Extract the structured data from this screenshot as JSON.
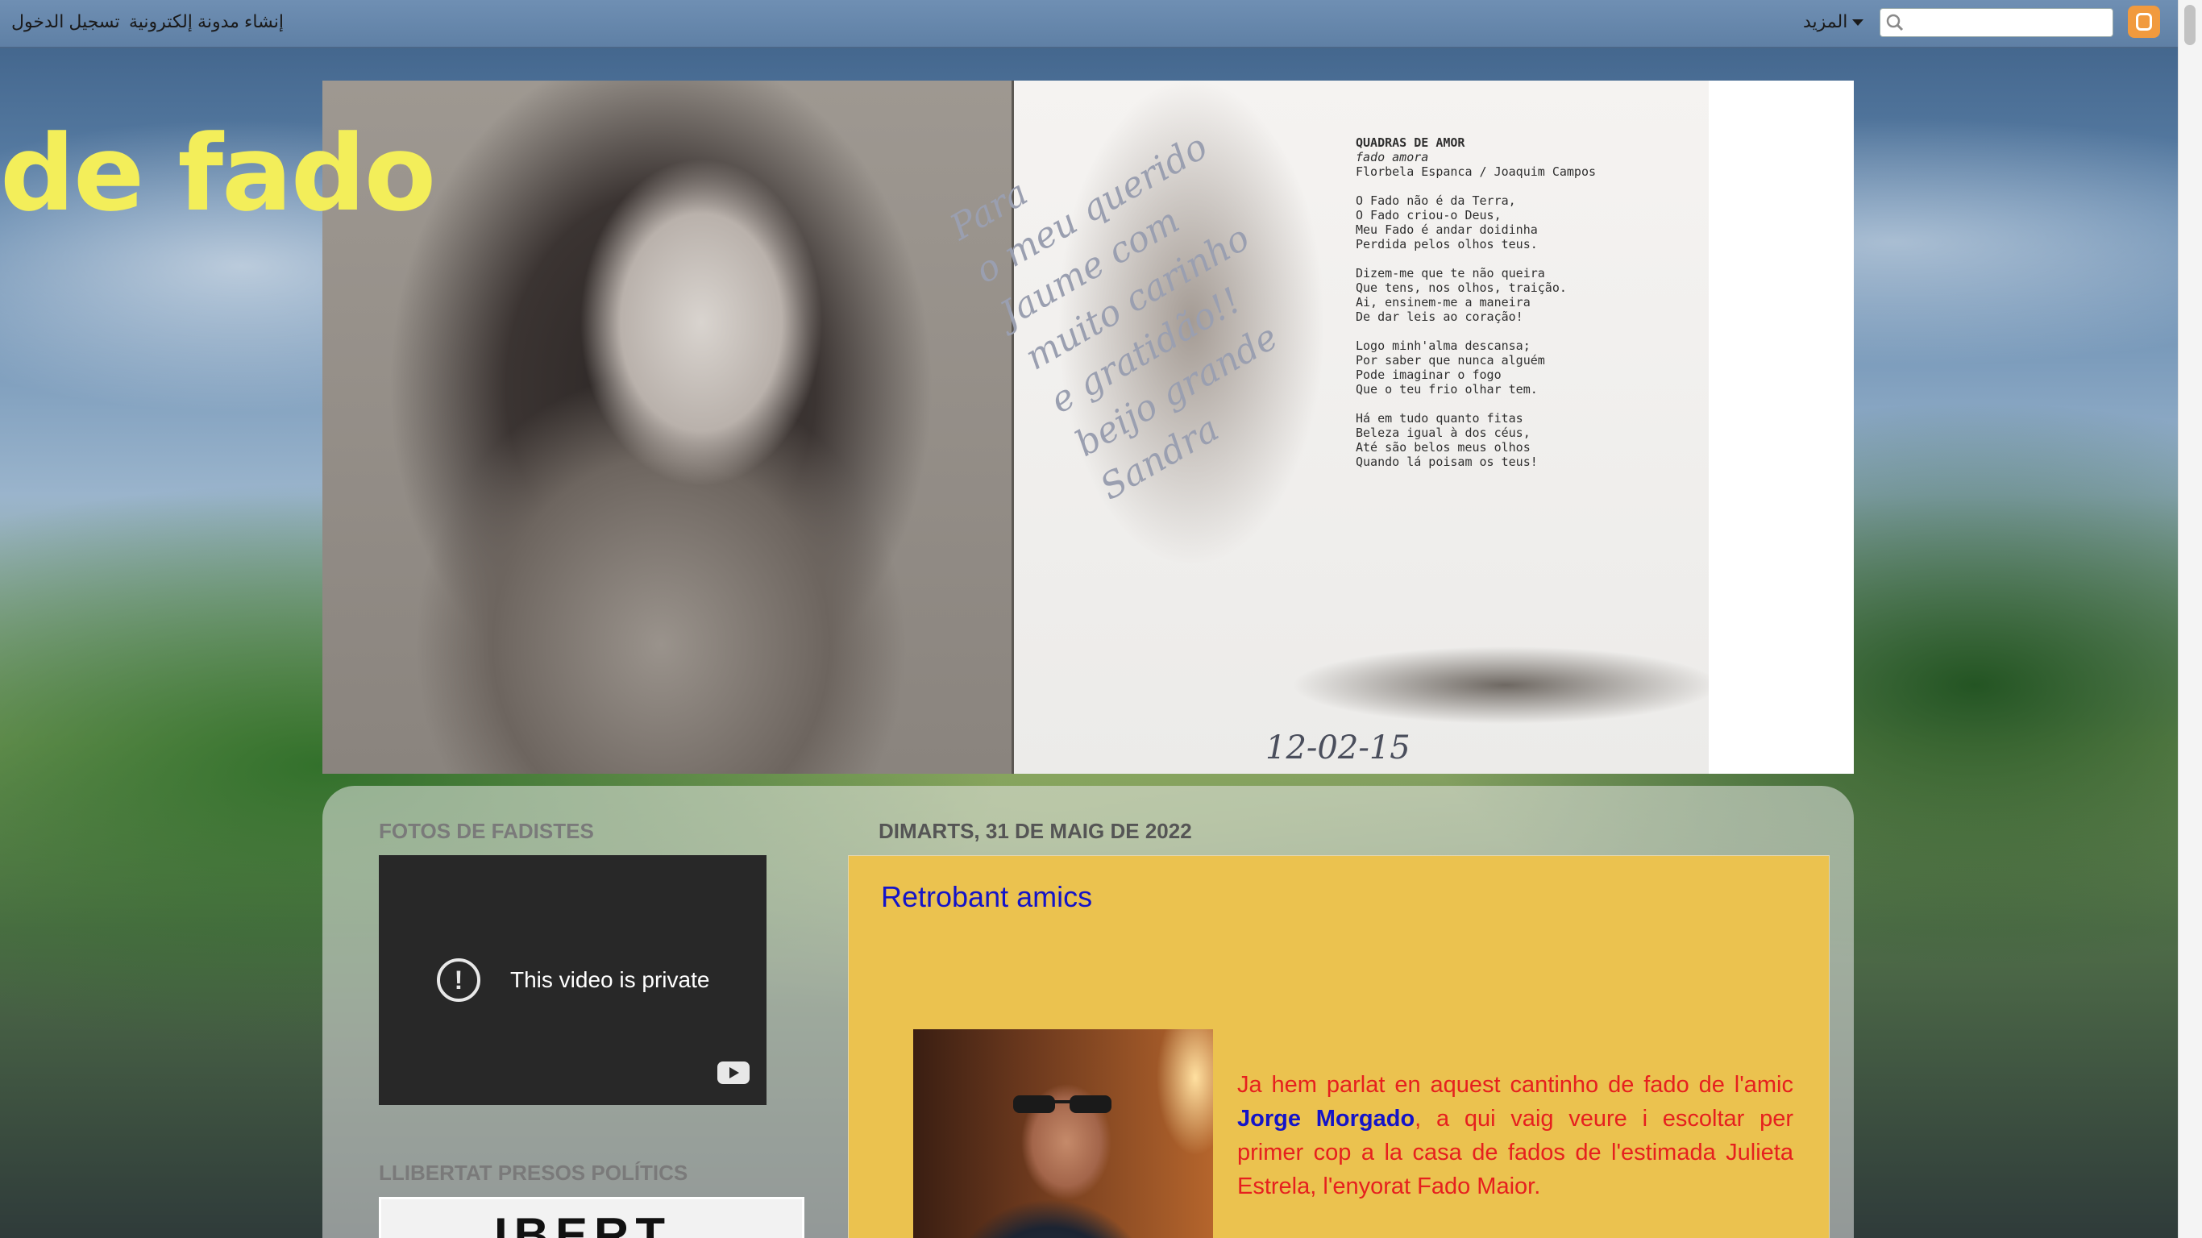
{
  "navbar": {
    "signin": "تسجيل الدخول",
    "create_blog": "إنشاء مدونة إلكترونية",
    "more": "المزيد",
    "search_placeholder": ""
  },
  "header": {
    "title": "de fado",
    "poem": {
      "heading": "QUADRAS DE AMOR",
      "subtitle": "fado amora",
      "authors": "Florbela Espanca / Joaquim Campos",
      "stanza1": "O Fado não é da Terra,\nO Fado criou-o Deus,\nMeu Fado é andar doidinha\nPerdida pelos olhos teus.",
      "stanza2": "Dizem-me que te não queira\nQue tens, nos olhos, traição.\nAi, ensinem-me a maneira\nDe dar leis ao coração!",
      "stanza3": "Logo minh'alma descansa;\nPor saber que nunca alguém\nPode imaginar o fogo\nQue o teu frio olhar tem.",
      "stanza4": "Há em tudo quanto fitas\nBeleza igual à dos céus,\nAté são belos meus olhos\nQuando lá poisam os teus!"
    },
    "handwriting": "Para\no meu querido\nJaume com\nmuito carinho\ne gratidão!!\nbeijo grande\nSandra",
    "handwritten_date": "12-02-15"
  },
  "sidebar": {
    "widget1_title": "FOTOS DE FADISTES",
    "video_message": "This video is private",
    "widget2_title": "LLIBERTAT PRESOS POLÍTICS",
    "widget2_image_text": "IBERT"
  },
  "post": {
    "date": "DIMARTS, 31 DE MAIG DE 2022",
    "title": "Retrobant amics",
    "text_before": "Ja hem parlat en aquest cantinho de fado de l'amic ",
    "name": "Jorge Morgado",
    "text_after": ", a qui vaig veure i escoltar per primer cop a la casa de fados de l'estimada  Julieta Estrela, l'enyorat Fado Maior."
  },
  "colors": {
    "title_yellow": "#f3ee5a",
    "post_background": "#ebc24f",
    "post_title": "#1414c8",
    "post_text": "#e6201e",
    "blogger_orange": "#f19a3e"
  }
}
